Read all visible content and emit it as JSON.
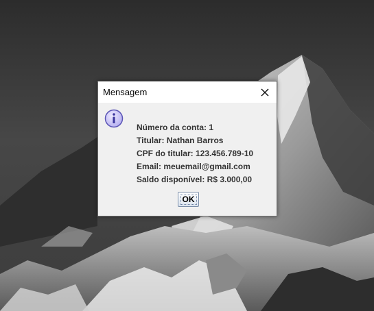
{
  "dialog": {
    "title": "Mensagem",
    "icon": "info-icon",
    "lines": [
      "Número da conta: 1",
      "Titular: Nathan Barros",
      "CPF do titular: 123.456.789-10",
      "Email: meuemail@gmail.com",
      "Saldo disponível: R$ 3.000,00"
    ],
    "ok_label": "OK"
  },
  "colors": {
    "dialog_background": "#f0f0f0",
    "titlebar_background": "#ffffff",
    "message_text": "#333333",
    "icon_fill": "#c9c6f5",
    "icon_outline": "#5b55b5"
  }
}
